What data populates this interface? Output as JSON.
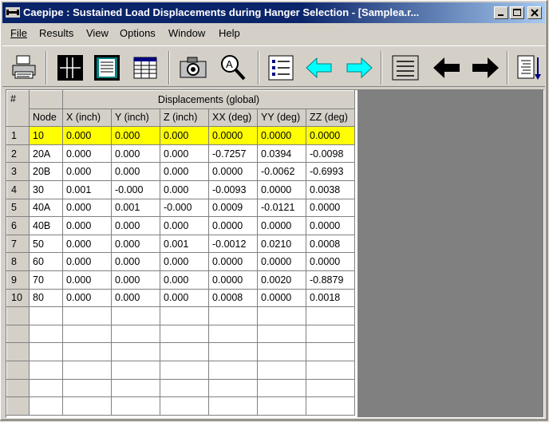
{
  "window": {
    "title": "Caepipe : Sustained Load Displacements during Hanger Selection -  [Samplea.r...",
    "minimize_label": "_",
    "maximize_label": "□",
    "close_label": "✕"
  },
  "menu": [
    "File",
    "Results",
    "View",
    "Options",
    "Window",
    "Help"
  ],
  "toolbar": [
    {
      "icon": "printer-icon"
    },
    {
      "icon": "grid-view-icon"
    },
    {
      "icon": "text-view-icon"
    },
    {
      "icon": "table-view-icon"
    },
    {
      "icon": "camera-icon"
    },
    {
      "icon": "zoom-icon"
    },
    {
      "icon": "list-icon"
    },
    {
      "icon": "cyan-left-arrow-icon"
    },
    {
      "icon": "cyan-right-arrow-icon"
    },
    {
      "icon": "lines-icon"
    },
    {
      "icon": "black-left-arrow-icon"
    },
    {
      "icon": "black-right-arrow-icon"
    },
    {
      "icon": "document-scroll-icon"
    }
  ],
  "table": {
    "corner": "#",
    "group_header": "Displacements (global)",
    "columns": [
      "Node",
      "X (inch)",
      "Y (inch)",
      "Z (inch)",
      "XX (deg)",
      "YY (deg)",
      "ZZ (deg)"
    ],
    "rows": [
      {
        "num": "1",
        "cells": [
          "10",
          "0.000",
          "0.000",
          "0.000",
          "0.0000",
          "0.0000",
          "0.0000"
        ]
      },
      {
        "num": "2",
        "cells": [
          "20A",
          "0.000",
          "0.000",
          "0.000",
          "-0.7257",
          "0.0394",
          "-0.0098"
        ]
      },
      {
        "num": "3",
        "cells": [
          "20B",
          "0.000",
          "0.000",
          "0.000",
          "0.0000",
          "-0.0062",
          "-0.6993"
        ]
      },
      {
        "num": "4",
        "cells": [
          "30",
          "0.001",
          "-0.000",
          "0.000",
          "-0.0093",
          "0.0000",
          "0.0038"
        ]
      },
      {
        "num": "5",
        "cells": [
          "40A",
          "0.000",
          "0.001",
          "-0.000",
          "0.0009",
          "-0.0121",
          "0.0000"
        ]
      },
      {
        "num": "6",
        "cells": [
          "40B",
          "0.000",
          "0.000",
          "0.000",
          "0.0000",
          "0.0000",
          "0.0000"
        ]
      },
      {
        "num": "7",
        "cells": [
          "50",
          "0.000",
          "0.000",
          "0.001",
          "-0.0012",
          "0.0210",
          "0.0008"
        ]
      },
      {
        "num": "8",
        "cells": [
          "60",
          "0.000",
          "0.000",
          "0.000",
          "0.0000",
          "0.0000",
          "0.0000"
        ]
      },
      {
        "num": "9",
        "cells": [
          "70",
          "0.000",
          "0.000",
          "0.000",
          "0.0000",
          "0.0020",
          "-0.8879"
        ]
      },
      {
        "num": "10",
        "cells": [
          "80",
          "0.000",
          "0.000",
          "0.000",
          "0.0008",
          "0.0000",
          "0.0018"
        ]
      }
    ],
    "empty_rows": 6,
    "highlight_color": "#ffff00"
  }
}
